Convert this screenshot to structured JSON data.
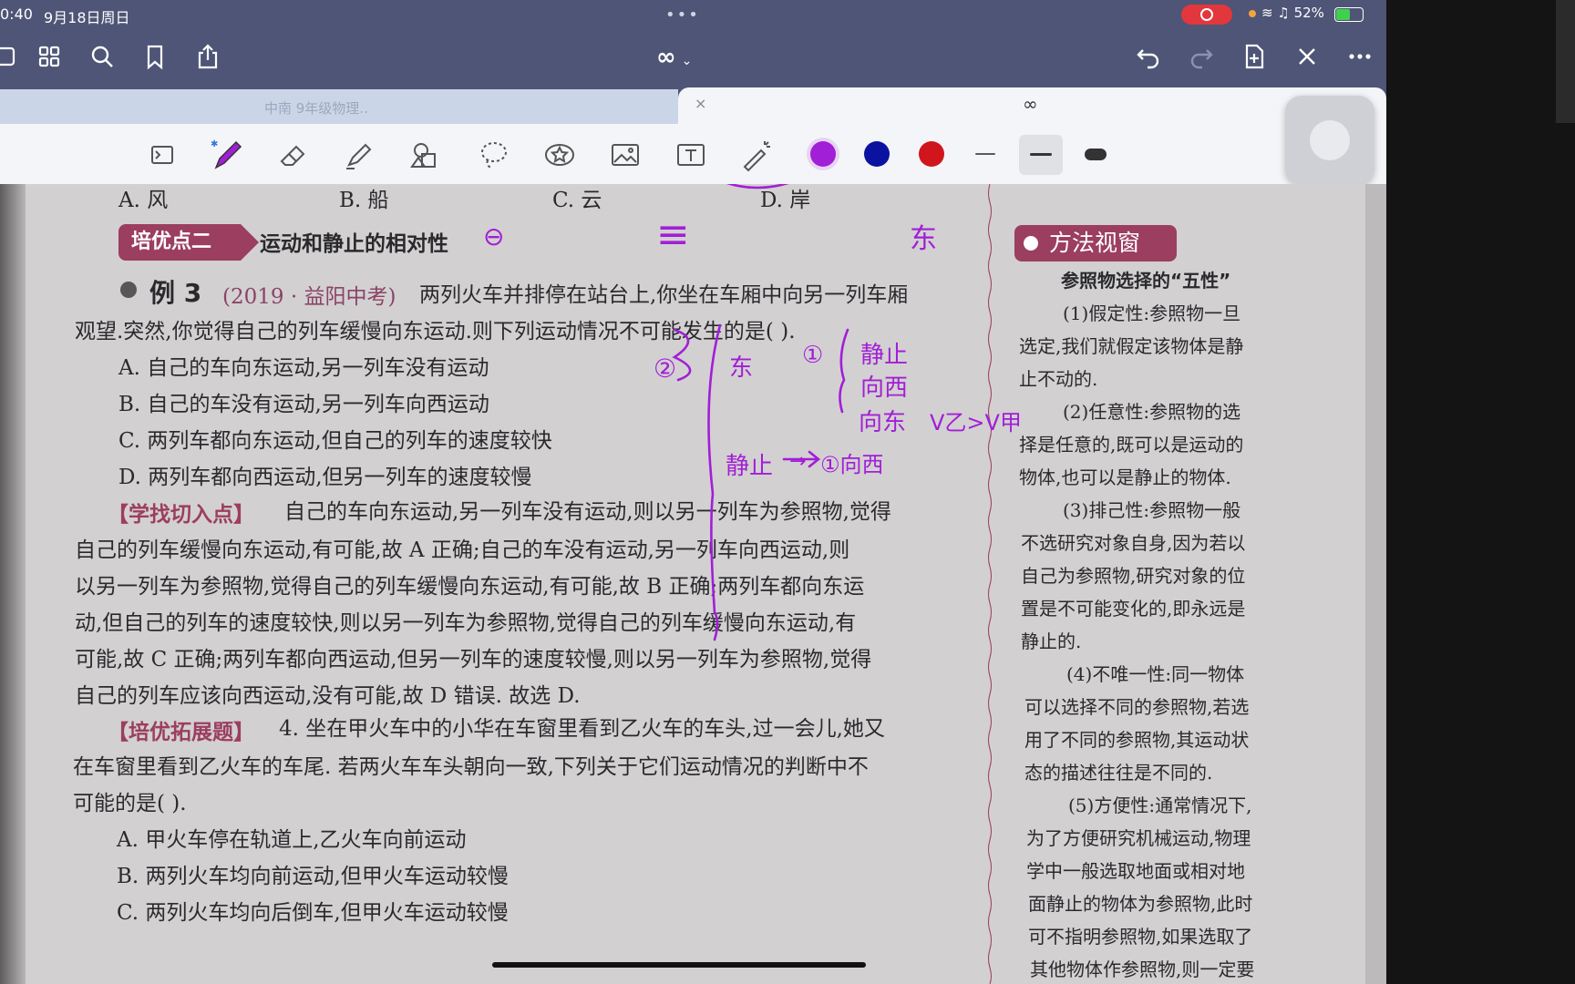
{
  "status": {
    "time": "0:40",
    "date": "9月18日周日",
    "battery": "52%"
  },
  "toolbar": {
    "title": "∞",
    "icons": [
      "sidebar-icon",
      "grid-icon",
      "search-icon",
      "bookmark-icon",
      "share-icon",
      "undo-icon",
      "redo-icon",
      "add-page-icon",
      "close-ink-icon",
      "more-icon"
    ]
  },
  "tabs": {
    "inactive": "中南 9年级物理..",
    "active": "∞",
    "close": "×"
  },
  "tools": {
    "colors": [
      "#a11fd6",
      "#0b12a0",
      "#d0161c"
    ],
    "selected_color": "#a11fd6"
  },
  "page": {
    "options_top": [
      "A. 风",
      "B. 船",
      "C. 云",
      "D. 岸"
    ],
    "section_tag": "培优点二",
    "section_title": "运动和静止的相对性",
    "example_label": "例 3",
    "example_source": "(2019 · 益阳中考)",
    "example_line1": "两列火车并排停在站台上,你坐在车厢中向另一列车厢",
    "example_line2": "观望.突然,你觉得自己的列车缓慢向东运动.则下列运动情况不可能发生的是(     ).",
    "choices": [
      "A. 自己的车向东运动,另一列车没有运动",
      "B. 自己的车没有运动,另一列车向西运动",
      "C. 两列车都向东运动,但自己的列车的速度较快",
      "D. 两列车都向西运动,但另一列车的速度较慢"
    ],
    "analysis_tag": "【学找切入点】",
    "analysis": [
      "自己的车向东运动,另一列车没有运动,则以另一列车为参照物,觉得",
      "自己的列车缓慢向东运动,有可能,故 A 正确;自己的车没有运动,另一列车向西运动,则",
      "以另一列车为参照物,觉得自己的列车缓慢向东运动,有可能,故 B 正确;两列车都向东运",
      "动,但自己的列车的速度较快,则以另一列车为参照物,觉得自己的列车缓慢向东运动,有",
      "可能,故 C 正确;两列车都向西运动,但另一列车的速度较慢,则以另一列车为参照物,觉得",
      "自己的列车应该向西运动,没有可能,故 D 错误. 故选 D."
    ],
    "extend_tag": "【培优拓展题】",
    "extend": [
      "4. 坐在甲火车中的小华在车窗里看到乙火车的车头,过一会儿,她又",
      "在车窗里看到乙火车的车尾. 若两火车车头朝向一致,下列关于它们运动情况的判断中不",
      "可能的是(     )."
    ],
    "extend_choices": [
      "A. 甲火车停在轨道上,乙火车向前运动",
      "B. 两列火车均向前运动,但甲火车运动较慢",
      "C. 两列火车均向后倒车,但甲火车运动较慢"
    ],
    "side_title": "方法视窗",
    "side_subtitle": "参照物选择的“五性”",
    "side_lines": [
      "(1)假定性:参照物一旦",
      "选定,我们就假定该物体是静",
      "止不动的.",
      "(2)任意性:参照物的选",
      "择是任意的,既可以是运动的",
      "物体,也可以是静止的物体.",
      "(3)排己性:参照物一般",
      "不选研究对象自身,因为若以",
      "自己为参照物,研究对象的位",
      "置是不可能变化的,即永远是",
      "静止的.",
      "(4)不唯一性:同一物体",
      "可以选择不同的参照物,若选",
      "用了不同的参照物,其运动状",
      "态的描述往往是不同的.",
      "(5)方便性:通常情况下,",
      "为了方便研究机械运动,物理",
      "学中一般选取地面或相对地",
      "面静止的物体为参照物,此时",
      "可不指明参照物,如果选取了",
      "其他物体作参照物,则一定要"
    ],
    "ink_notes": [
      "东",
      "②",
      "东",
      "①",
      "静止",
      "向西",
      "向东",
      "V乙>V甲",
      "静止",
      "→",
      "①向西",
      "⊖",
      "≡"
    ]
  }
}
